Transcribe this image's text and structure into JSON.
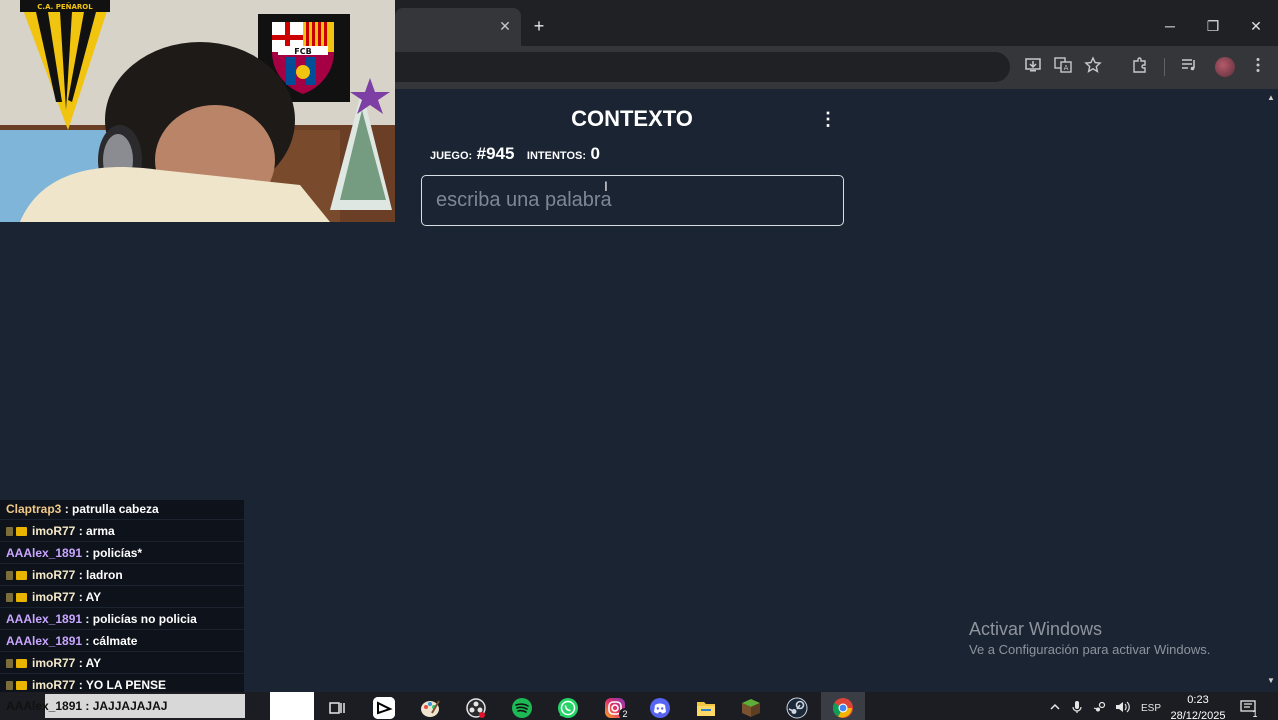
{
  "browser": {
    "new_tab_glyph": "+",
    "tab_close_glyph": "✕",
    "window_controls": {
      "minimize": "─",
      "restore": "❐",
      "close": "✕"
    },
    "toolbar_icons": [
      "install-icon",
      "translate-icon",
      "star-icon",
      "extensions-icon",
      "media-icon",
      "profile-avatar",
      "more-icon"
    ]
  },
  "game": {
    "title": "CONTEXTO",
    "game_label": "JUEGO:",
    "game_number": "#945",
    "attempts_label": "INTENTOS:",
    "attempts_value": "0",
    "input_placeholder": "escriba una palabra",
    "menu_glyph": "⋮"
  },
  "webcam": {
    "pennant_text": "C.A. PEÑAROL",
    "crest_text": "FCB"
  },
  "chat": {
    "messages": [
      {
        "user": "Claptrap3",
        "text": "patrulla cabeza",
        "badges": false,
        "user_color": "#f0c987"
      },
      {
        "user": "imoR77",
        "text": "arma",
        "badges": true,
        "user_color": "#f5e9c8"
      },
      {
        "user": "AAAlex_1891",
        "text": "policías*",
        "badges": false,
        "user_color": "#c9a6ff"
      },
      {
        "user": "imoR77",
        "text": "ladron",
        "badges": true,
        "user_color": "#f5e9c8"
      },
      {
        "user": "imoR77",
        "text": "AY",
        "badges": true,
        "user_color": "#f5e9c8"
      },
      {
        "user": "AAAlex_1891",
        "text": "policías no policia",
        "badges": false,
        "user_color": "#c9a6ff"
      },
      {
        "user": "AAAlex_1891",
        "text": "cálmate",
        "badges": false,
        "user_color": "#c9a6ff"
      },
      {
        "user": "imoR77",
        "text": "AY",
        "badges": true,
        "user_color": "#f5e9c8"
      },
      {
        "user": "imoR77",
        "text": "YO LA PENSE",
        "badges": true,
        "user_color": "#f5e9c8"
      }
    ],
    "last_message": "AAAlex_1891 : JAJJAJAJAJ",
    "separator": " : "
  },
  "windows_watermark": {
    "title": "Activar Windows",
    "subtitle": "Ve a Configuración para activar Windows."
  },
  "taskbar": {
    "apps": [
      "task-view-icon",
      "capcut-icon",
      "paint-icon",
      "obs-icon",
      "spotify-icon",
      "whatsapp-icon",
      "instagram-icon",
      "discord-icon",
      "file-explorer-icon",
      "minecraft-icon",
      "steam-icon",
      "chrome-icon"
    ],
    "instagram_badge": "2",
    "tray_language": "ESP",
    "clock_time": "0:23",
    "clock_date": "28/12/2025",
    "notification_badge": "1"
  },
  "colors": {
    "page_bg": "#1b2433",
    "chrome_tabbar": "#202124",
    "chrome_toolbar": "#35363a",
    "chat_bg": "#0e131b",
    "taskbar_bg": "#1b1d22"
  }
}
